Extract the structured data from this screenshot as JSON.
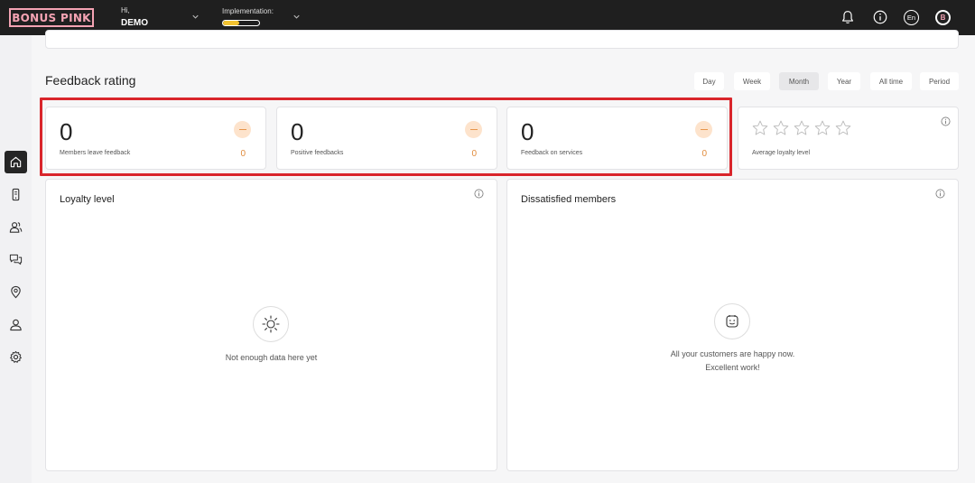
{
  "header": {
    "logo_text": "BONUS PINK",
    "greeting": "Hi,",
    "user_name": "DEMO",
    "implementation_label": "Implementation:",
    "implementation_progress": 0.45,
    "language": "En",
    "avatar_letter": "B"
  },
  "colors": {
    "brand_pink": "#f4a3b3",
    "accent_orange": "#e08b3c",
    "highlight_red": "#d9252b",
    "progress_yellow": "#f2c230"
  },
  "sidebar": {
    "items": [
      {
        "icon": "home-icon",
        "active": true
      },
      {
        "icon": "phone-icon",
        "active": false
      },
      {
        "icon": "users-icon",
        "active": false
      },
      {
        "icon": "chat-icon",
        "active": false
      },
      {
        "icon": "location-pin-icon",
        "active": false
      },
      {
        "icon": "user-icon",
        "active": false
      },
      {
        "icon": "gear-icon",
        "active": false
      }
    ]
  },
  "section": {
    "title": "Feedback rating",
    "periods": [
      "Day",
      "Week",
      "Month",
      "Year",
      "All time",
      "Period"
    ],
    "active_period": "Month"
  },
  "stats": [
    {
      "value": "0",
      "label": "Members leave feedback",
      "delta": "0"
    },
    {
      "value": "0",
      "label": "Positive feedbacks",
      "delta": "0"
    },
    {
      "value": "0",
      "label": "Feedback on services",
      "delta": "0"
    }
  ],
  "loyalty_card": {
    "label": "Average loyalty level",
    "stars_filled": 0,
    "stars_total": 5
  },
  "loyalty_panel": {
    "title": "Loyalty level",
    "empty_text": "Not enough data here yet"
  },
  "dissatisfied_panel": {
    "title": "Dissatisfied members",
    "empty_line1": "All your customers are happy now.",
    "empty_line2": "Excellent work!"
  }
}
